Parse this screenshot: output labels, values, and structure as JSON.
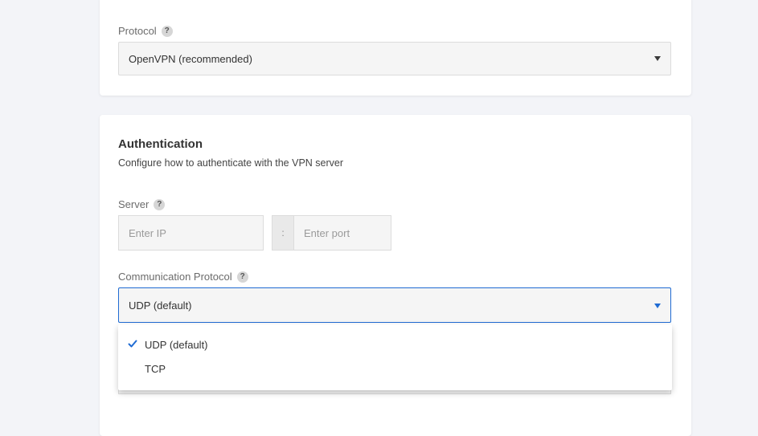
{
  "vpn_protocol": {
    "label": "Protocol",
    "help_icon": "?",
    "selected": "OpenVPN (recommended)"
  },
  "authentication": {
    "title": "Authentication",
    "description": "Configure how to authenticate with the VPN server",
    "server": {
      "label": "Server",
      "help_icon": "?",
      "ip_placeholder": "Enter IP",
      "separator": ":",
      "port_placeholder": "Enter port"
    },
    "communication_protocol": {
      "label": "Communication Protocol",
      "help_icon": "?",
      "selected": "UDP (default)",
      "options": [
        {
          "label": "UDP (default)",
          "checked": true
        },
        {
          "label": "TCP",
          "checked": false
        }
      ]
    }
  },
  "colors": {
    "accent": "#1f6bd3",
    "background": "#f3f4f8",
    "card": "#ffffff"
  }
}
